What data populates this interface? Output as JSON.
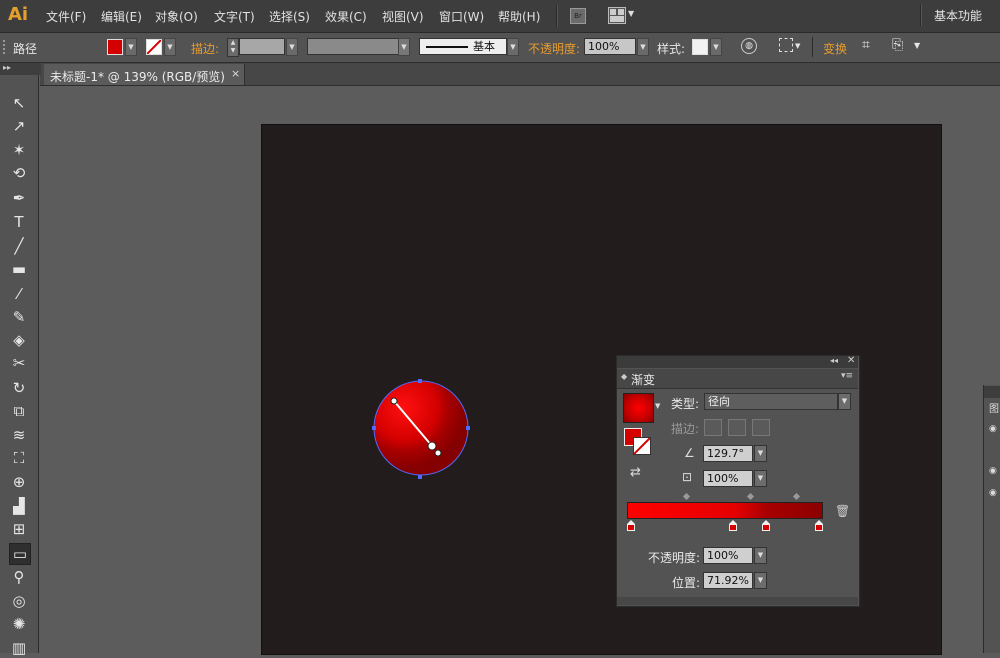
{
  "app": {
    "logo": "Ai"
  },
  "menu": {
    "items": [
      "文件(F)",
      "编辑(E)",
      "对象(O)",
      "文字(T)",
      "选择(S)",
      "效果(C)",
      "视图(V)",
      "窗口(W)",
      "帮助(H)"
    ],
    "bridge_label": "Br",
    "workspace": "基本功能"
  },
  "control_bar": {
    "selection_label": "路径",
    "fill_color": "#d40000",
    "stroke_label": "描边:",
    "brush_label": "基本",
    "opacity_label": "不透明度:",
    "opacity_value": "100%",
    "style_label": "样式:",
    "transform_label": "变换"
  },
  "document": {
    "tab_title": "未标题-1* @ 139% (RGB/预览)",
    "close_glyph": "×"
  },
  "tools": [
    {
      "name": "selection-tool-icon",
      "glyph": "↖"
    },
    {
      "name": "direct-selection-tool-icon",
      "glyph": "↗"
    },
    {
      "name": "magic-wand-tool-icon",
      "glyph": "✶"
    },
    {
      "name": "lasso-tool-icon",
      "glyph": "⟲"
    },
    {
      "name": "pen-tool-icon",
      "glyph": "✒"
    },
    {
      "name": "type-tool-icon",
      "glyph": "T"
    },
    {
      "name": "line-tool-icon",
      "glyph": "╱"
    },
    {
      "name": "rectangle-tool-icon",
      "glyph": "▬"
    },
    {
      "name": "paintbrush-tool-icon",
      "glyph": "⁄"
    },
    {
      "name": "pencil-tool-icon",
      "glyph": "✎"
    },
    {
      "name": "blob-brush-tool-icon",
      "glyph": "◈"
    },
    {
      "name": "scissors-tool-icon",
      "glyph": "✂"
    },
    {
      "name": "rotate-tool-icon",
      "glyph": "↻"
    },
    {
      "name": "scale-tool-icon",
      "glyph": "⧉"
    },
    {
      "name": "warp-tool-icon",
      "glyph": "≋"
    },
    {
      "name": "free-transform-tool-icon",
      "glyph": "⛶"
    },
    {
      "name": "shape-builder-tool-icon",
      "glyph": "⊕"
    },
    {
      "name": "graph-tool-icon",
      "glyph": "▟"
    },
    {
      "name": "mesh-tool-icon",
      "glyph": "⊞"
    },
    {
      "name": "gradient-tool-icon",
      "glyph": "▭"
    },
    {
      "name": "eyedropper-tool-icon",
      "glyph": "⚲"
    },
    {
      "name": "blend-tool-icon",
      "glyph": "◎"
    },
    {
      "name": "symbol-sprayer-tool-icon",
      "glyph": "✺"
    },
    {
      "name": "column-graph-tool-icon",
      "glyph": "▥"
    }
  ],
  "gradient_panel": {
    "title": "渐变",
    "type_label": "类型:",
    "type_value": "径向",
    "stroke_label": "描边:",
    "angle_value": "129.7°",
    "aspect_value": "100%",
    "opacity_label": "不透明度:",
    "opacity_value": "100%",
    "location_label": "位置:",
    "location_value": "71.92%",
    "stops_percent": [
      0,
      54,
      72,
      100
    ],
    "midpoints_percent": [
      30,
      63,
      86
    ]
  },
  "colors": {
    "fill_red": "#d40000",
    "accent_orange": "#e79c2d",
    "artboard": "#231c1c",
    "selection_blue": "#4f6bff"
  }
}
